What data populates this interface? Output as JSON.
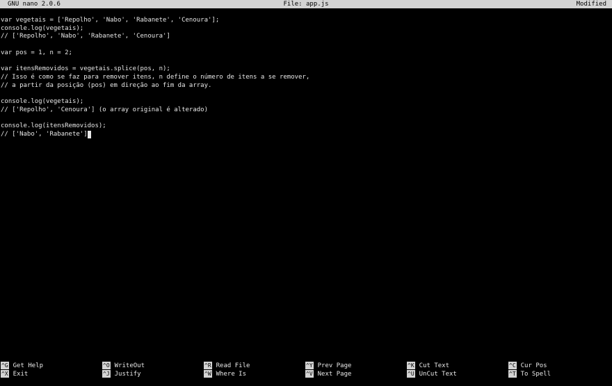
{
  "titlebar": {
    "app": "GNU nano 2.0.6",
    "file": "File: app.js",
    "status": "Modified"
  },
  "editor": {
    "lines": [
      "var vegetais = ['Repolho', 'Nabo', 'Rabanete', 'Cenoura'];",
      "console.log(vegetais);",
      "// ['Repolho', 'Nabo', 'Rabanete', 'Cenoura']",
      "",
      "var pos = 1, n = 2;",
      "",
      "var itensRemovidos = vegetais.splice(pos, n);",
      "// Isso é como se faz para remover itens, n define o número de itens a se remover,",
      "// a partir da posição (pos) em direção ao fim da array.",
      "",
      "console.log(vegetais);",
      "// ['Repolho', 'Cenoura'] (o array original é alterado)",
      "",
      "console.log(itensRemovidos);",
      "// ['Nabo', 'Rabanete']"
    ]
  },
  "shortcuts": {
    "row1": [
      {
        "key": "^G",
        "label": "Get Help"
      },
      {
        "key": "^O",
        "label": "WriteOut"
      },
      {
        "key": "^R",
        "label": "Read File"
      },
      {
        "key": "^Y",
        "label": "Prev Page"
      },
      {
        "key": "^K",
        "label": "Cut Text"
      },
      {
        "key": "^C",
        "label": "Cur Pos"
      }
    ],
    "row2": [
      {
        "key": "^X",
        "label": "Exit"
      },
      {
        "key": "^J",
        "label": "Justify"
      },
      {
        "key": "^W",
        "label": "Where Is"
      },
      {
        "key": "^V",
        "label": "Next Page"
      },
      {
        "key": "^U",
        "label": "UnCut Text"
      },
      {
        "key": "^T",
        "label": "To Spell"
      }
    ]
  }
}
